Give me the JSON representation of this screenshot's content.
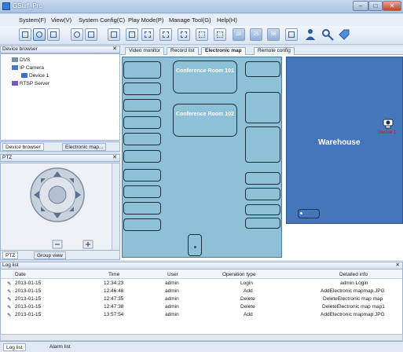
{
  "app": {
    "title": "GSurf_Pro"
  },
  "menu": [
    "System(F)",
    "View(V)",
    "System Config(C)",
    "Play Mode(P)",
    "Manage Tool(G)",
    "Help(H)"
  ],
  "toolbar": {
    "numbered": [
      "20",
      "25",
      "36"
    ]
  },
  "device_browser": {
    "title": "Device browser",
    "tree": [
      "DVS",
      "IP Camera",
      "Device 1",
      "RTSP Server"
    ],
    "tabs": [
      "Device browser",
      "Electronic map..."
    ]
  },
  "ptz": {
    "title": "PTZ",
    "tabs": [
      "PTZ",
      "Group view"
    ]
  },
  "center_tabs": [
    "Video monitor",
    "Record list",
    "Electronic map",
    "Remote config"
  ],
  "map": {
    "rooms": [
      "Conference Room 101",
      "Conference Room 102"
    ],
    "warehouse": "Warehouse",
    "device_label": "Device 1"
  },
  "log": {
    "title": "Log list",
    "columns": [
      "Date",
      "Time",
      "User",
      "Operation type",
      "Detailed info"
    ],
    "rows": [
      [
        "2013-01-15",
        "12:34:23",
        "admin",
        "Login",
        "admin Login"
      ],
      [
        "2013-01-15",
        "12:46:48",
        "admin",
        "Add",
        "AddElectronic mapmap.JPG"
      ],
      [
        "2013-01-15",
        "12:47:35",
        "admin",
        "Delete",
        "DeleteElectronic map map"
      ],
      [
        "2013-01-15",
        "12:47:38",
        "admin",
        "Delete",
        "DeleteElectronic map map1"
      ],
      [
        "2013-01-15",
        "13:57:54",
        "admin",
        "Add",
        "AddElectronic mapmap.JPG"
      ]
    ]
  },
  "bottom_tabs": [
    "Log list",
    "Alarm list"
  ]
}
